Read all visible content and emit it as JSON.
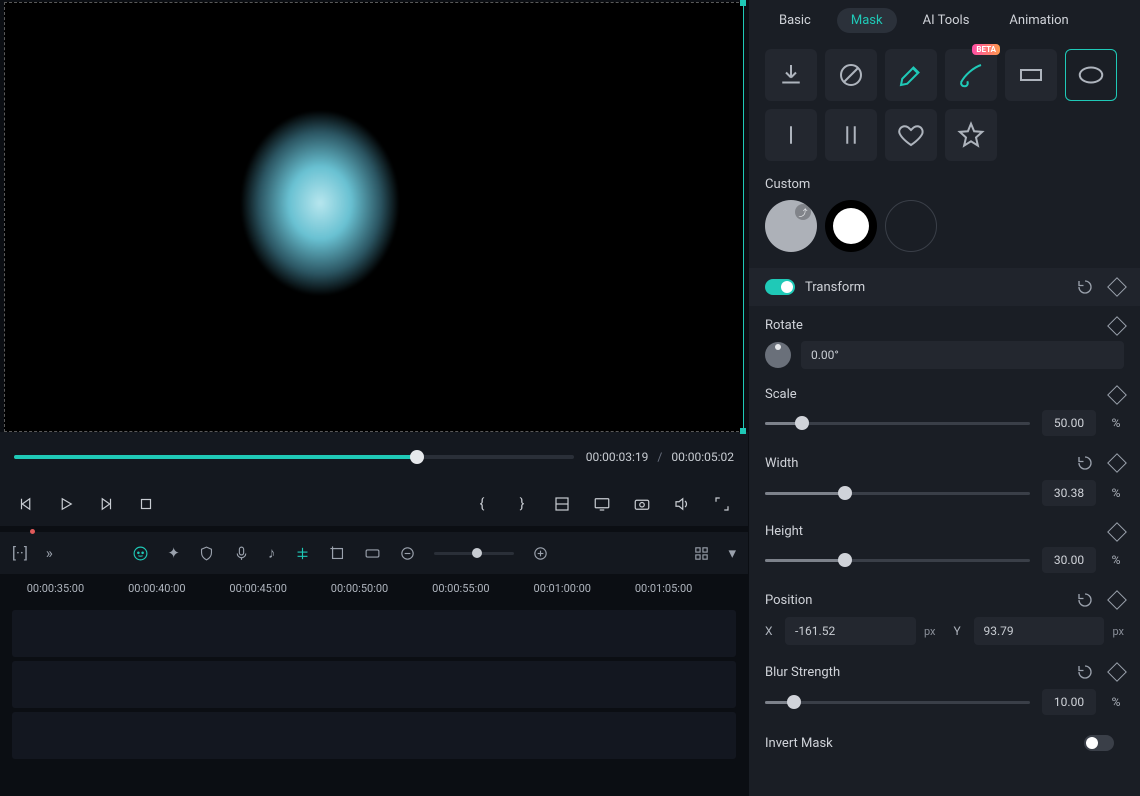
{
  "tabs": {
    "basic": "Basic",
    "mask": "Mask",
    "aiTools": "AI Tools",
    "animation": "Animation"
  },
  "shapes": {
    "beta": "BETA"
  },
  "customLabel": "Custom",
  "transform": {
    "label": "Transform",
    "rotate": {
      "label": "Rotate",
      "value": "0.00°"
    },
    "scale": {
      "label": "Scale",
      "value": "50.00",
      "unit": "%",
      "pct": 14
    },
    "width": {
      "label": "Width",
      "value": "30.38",
      "unit": "%",
      "pct": 30
    },
    "height": {
      "label": "Height",
      "value": "30.00",
      "unit": "%",
      "pct": 30
    },
    "position": {
      "label": "Position",
      "xLabel": "X",
      "x": "-161.52",
      "xUnit": "px",
      "yLabel": "Y",
      "y": "93.79",
      "yUnit": "px"
    },
    "blur": {
      "label": "Blur Strength",
      "value": "10.00",
      "unit": "%",
      "pct": 11
    },
    "invertLabel": "Invert Mask"
  },
  "transport": {
    "current": "00:00:03:19",
    "total": "00:00:05:02",
    "seekPct": 72
  },
  "ruler": [
    "00:00:35:00",
    "00:00:40:00",
    "00:00:45:00",
    "00:00:50:00",
    "00:00:55:00",
    "00:01:00:00",
    "00:01:05:00"
  ]
}
